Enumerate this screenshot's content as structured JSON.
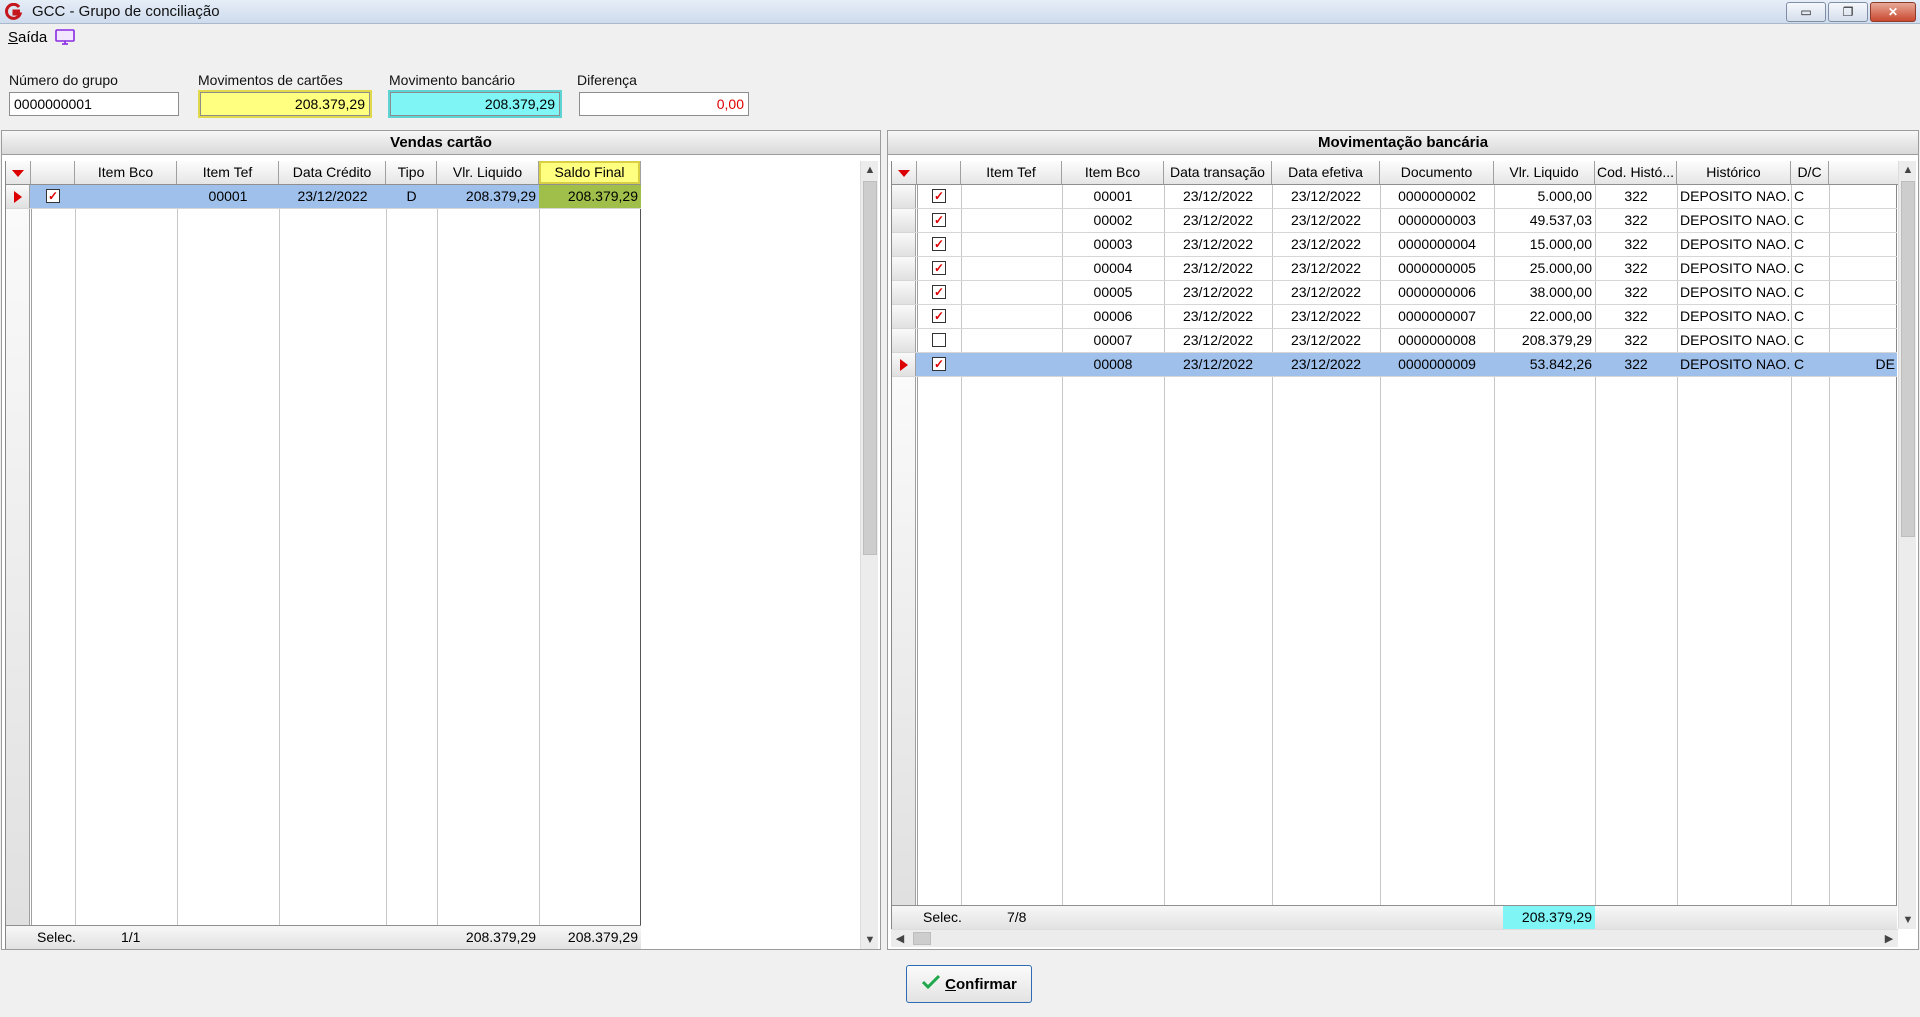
{
  "window": {
    "title": "GCC - Grupo de conciliação"
  },
  "menu": {
    "saida_accel": "S",
    "saida_rest": "aída"
  },
  "fields": {
    "numero_grupo": {
      "label": "Número do grupo",
      "value": "0000000001"
    },
    "mov_cartoes": {
      "label": "Movimentos de cartões",
      "value": "208.379,29"
    },
    "mov_bancario": {
      "label": "Movimento bancário",
      "value": "208.379,29"
    },
    "diferenca": {
      "label": "Diferença",
      "value": "0,00"
    }
  },
  "vendas": {
    "title": "Vendas cartão",
    "columns": [
      "Item Bco",
      "Item Tef",
      "Data Crédito",
      "Tipo",
      "Vlr. Liquido",
      "Saldo Final"
    ],
    "rows": [
      {
        "checked": true,
        "item_bco": "",
        "item_tef": "00001",
        "data": "23/12/2022",
        "tipo": "D",
        "valor": "208.379,29",
        "saldo": "208.379,29"
      }
    ],
    "footer": {
      "label": "Selec.",
      "count": "1/1",
      "total_valor": "208.379,29",
      "total_saldo": "208.379,29"
    }
  },
  "banco": {
    "title": "Movimentação bancária",
    "columns": [
      "Item Tef",
      "Item Bco",
      "Data transação",
      "Data efetiva",
      "Documento",
      "Vlr. Liquido",
      "Cod. Histó...",
      "Histórico",
      "D/C"
    ],
    "rows": [
      {
        "checked": true,
        "item_tef": "",
        "item_bco": "00001",
        "data_trans": "23/12/2022",
        "data_efet": "23/12/2022",
        "documento": "0000000002",
        "valor": "5.000,00",
        "cod": "322",
        "historico": "DEPOSITO NAO...",
        "dc": "C",
        "extra": ""
      },
      {
        "checked": true,
        "item_tef": "",
        "item_bco": "00002",
        "data_trans": "23/12/2022",
        "data_efet": "23/12/2022",
        "documento": "0000000003",
        "valor": "49.537,03",
        "cod": "322",
        "historico": "DEPOSITO NAO...",
        "dc": "C",
        "extra": ""
      },
      {
        "checked": true,
        "item_tef": "",
        "item_bco": "00003",
        "data_trans": "23/12/2022",
        "data_efet": "23/12/2022",
        "documento": "0000000004",
        "valor": "15.000,00",
        "cod": "322",
        "historico": "DEPOSITO NAO...",
        "dc": "C",
        "extra": ""
      },
      {
        "checked": true,
        "item_tef": "",
        "item_bco": "00004",
        "data_trans": "23/12/2022",
        "data_efet": "23/12/2022",
        "documento": "0000000005",
        "valor": "25.000,00",
        "cod": "322",
        "historico": "DEPOSITO NAO...",
        "dc": "C",
        "extra": ""
      },
      {
        "checked": true,
        "item_tef": "",
        "item_bco": "00005",
        "data_trans": "23/12/2022",
        "data_efet": "23/12/2022",
        "documento": "0000000006",
        "valor": "38.000,00",
        "cod": "322",
        "historico": "DEPOSITO NAO...",
        "dc": "C",
        "extra": ""
      },
      {
        "checked": true,
        "item_tef": "",
        "item_bco": "00006",
        "data_trans": "23/12/2022",
        "data_efet": "23/12/2022",
        "documento": "0000000007",
        "valor": "22.000,00",
        "cod": "322",
        "historico": "DEPOSITO NAO...",
        "dc": "C",
        "extra": ""
      },
      {
        "checked": false,
        "item_tef": "",
        "item_bco": "00007",
        "data_trans": "23/12/2022",
        "data_efet": "23/12/2022",
        "documento": "0000000008",
        "valor": "208.379,29",
        "cod": "322",
        "historico": "DEPOSITO NAO...",
        "dc": "C",
        "extra": ""
      },
      {
        "checked": true,
        "item_tef": "",
        "item_bco": "00008",
        "data_trans": "23/12/2022",
        "data_efet": "23/12/2022",
        "documento": "0000000009",
        "valor": "53.842,26",
        "cod": "322",
        "historico": "DEPOSITO NAO...",
        "dc": "C",
        "extra": "DE"
      }
    ],
    "footer": {
      "label": "Selec.",
      "count": "7/8",
      "total_valor": "208.379,29"
    }
  },
  "confirm": {
    "accel": "C",
    "rest": "onfirmar"
  },
  "icons": {
    "app": "gcc-logo-icon",
    "check": "check-icon"
  },
  "colors": {
    "yellow": "#ffff80",
    "cyan": "#7ff5f5",
    "selected_row": "#9ec0eb",
    "red": "#dd0000"
  }
}
